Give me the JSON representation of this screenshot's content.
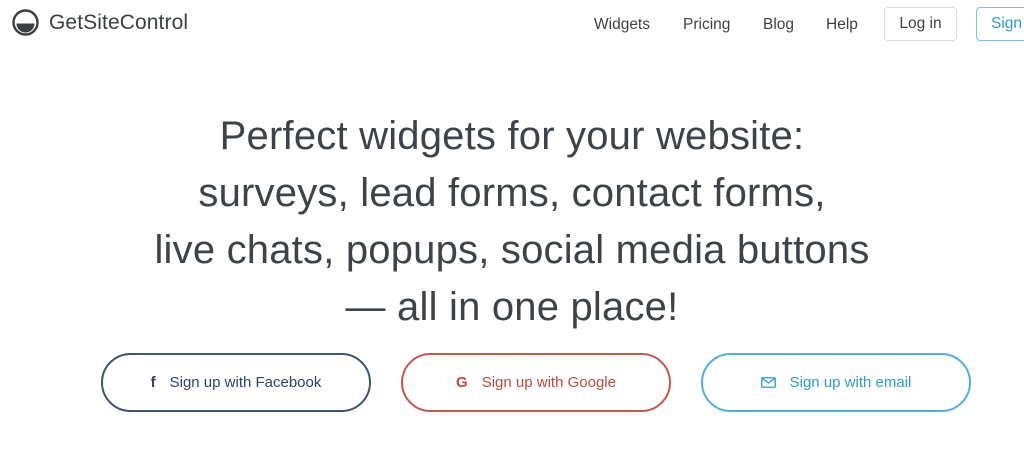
{
  "header": {
    "logo_text": "GetSiteControl",
    "nav": {
      "widgets": "Widgets",
      "pricing": "Pricing",
      "blog": "Blog",
      "help": "Help"
    },
    "login_label": "Log in",
    "signup_label": "Sign"
  },
  "hero": {
    "lines": [
      "Perfect widgets for your website:",
      "surveys, lead forms, contact forms,",
      "live chats, popups, social media buttons",
      "— all in one place!"
    ]
  },
  "cta": {
    "facebook": {
      "icon": "facebook-icon",
      "label": "Sign up with Facebook",
      "color": "#3b5673"
    },
    "google": {
      "icon": "google-icon",
      "label": "Sign up with Google",
      "color": "#c4584a"
    },
    "email": {
      "icon": "envelope-icon",
      "label": "Sign up with email",
      "color": "#4fb0dc"
    }
  }
}
